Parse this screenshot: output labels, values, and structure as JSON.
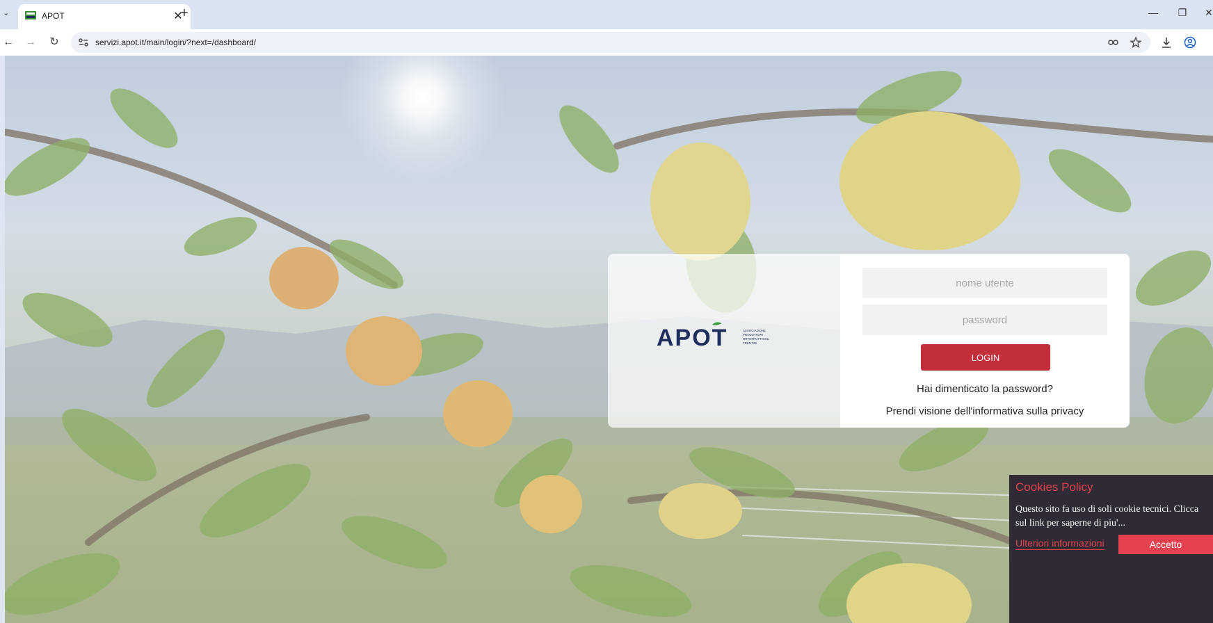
{
  "browser": {
    "tab_title": "APOT",
    "tab_close": "✕",
    "new_tab": "+",
    "url": "servizi.apot.it/main/login/?next=/dashboard/",
    "controls": {
      "minimize": "—",
      "restore": "❐",
      "close": "✕"
    }
  },
  "logo": {
    "wordmark": "APOT",
    "tagline_lines": [
      "ASSOCIAZIONE",
      "PRODUTTORI",
      "ORTOFRUTTICOLI",
      "TRENTINI"
    ]
  },
  "login": {
    "username_placeholder": "nome utente",
    "password_placeholder": "password",
    "login_label": "LOGIN",
    "forgot_password": "Hai dimenticato la password?",
    "privacy_link": "Prendi visione dell'informativa sulla privacy"
  },
  "cookie": {
    "title": "Cookies Policy",
    "text": "Questo sito fa uso di soli cookie tecnici. Clicca sul link per saperne di piu'...",
    "more_link": "Ulteriori informazioni",
    "accept_label": "Accetto"
  },
  "colors": {
    "accent": "#c22e3a",
    "cookie_bg": "#2f2a33",
    "cookie_accent": "#e5414f",
    "logo_navy": "#1f2d5c",
    "logo_green": "#3a9a3a"
  },
  "icons": [
    "tab-list-icon",
    "favicon-icon",
    "back-icon",
    "forward-icon",
    "reload-icon",
    "site-info-icon",
    "password-key-icon",
    "bookmark-star-icon",
    "download-icon",
    "profile-icon"
  ]
}
